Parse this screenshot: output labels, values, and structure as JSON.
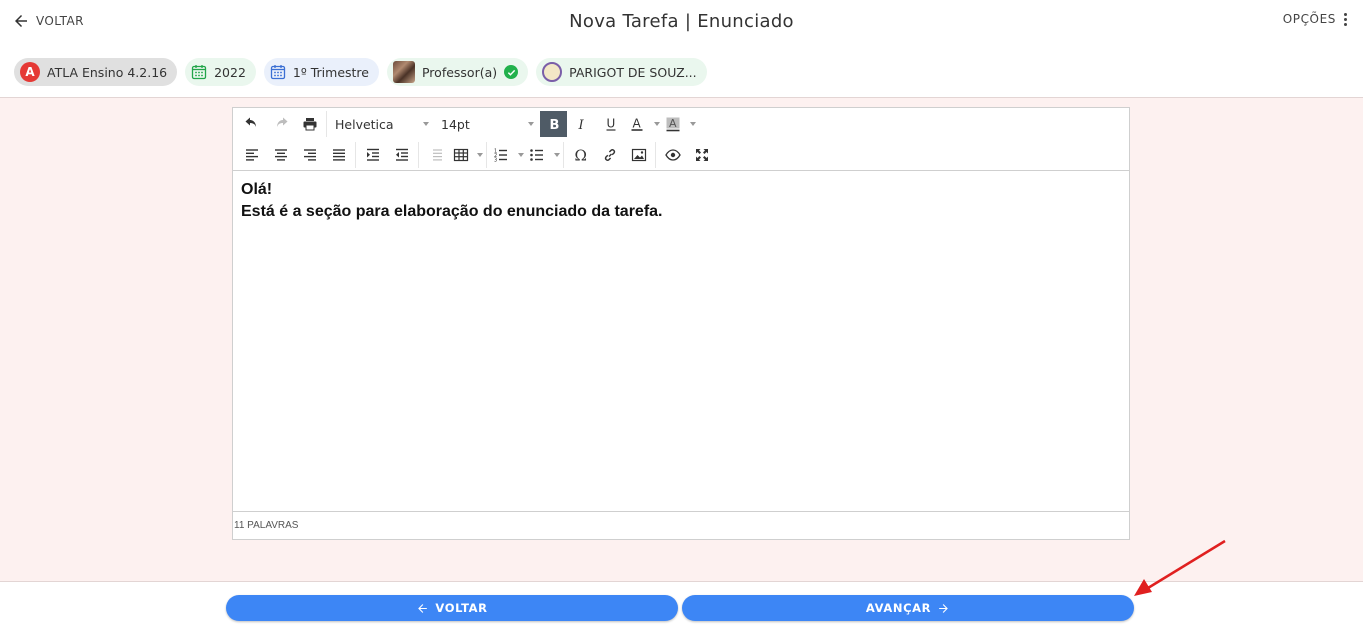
{
  "header": {
    "back_label": "VOLTAR",
    "title": "Nova Tarefa | Enunciado",
    "options_label": "OPÇÕES"
  },
  "chips": {
    "app": "ATLA Ensino 4.2.16",
    "year": "2022",
    "term": "1º Trimestre",
    "role": "Professor(a)",
    "school": "PARIGOT DE SOUZ..."
  },
  "editor": {
    "font_family": "Helvetica",
    "font_size": "14pt",
    "lines": [
      "Olá!",
      "Está é a seção para elaboração do enunciado da tarefa."
    ],
    "word_count": "11 PALAVRAS"
  },
  "footer": {
    "back_label": "VOLTAR",
    "next_label": "AVANÇAR"
  },
  "colors": {
    "primary": "#3d86f5",
    "background": "#fdf1f0",
    "annotation": "#e02020"
  }
}
